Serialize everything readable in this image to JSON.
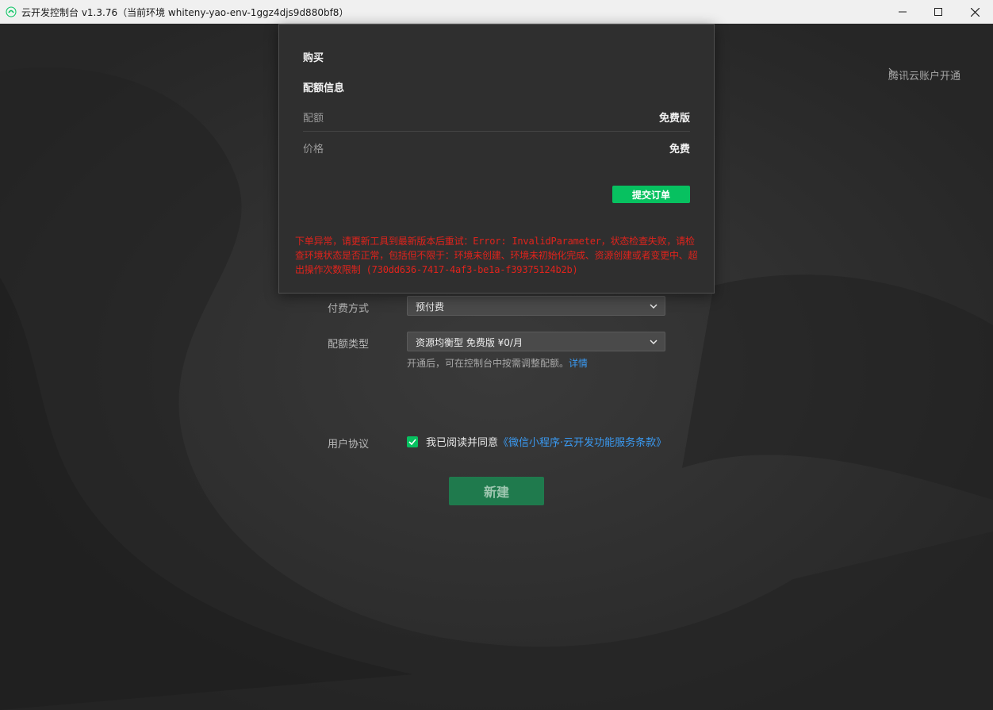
{
  "window": {
    "title": "云开发控制台 v1.3.76（当前环境 whiteny-yao-env-1ggz4djs9d880bf8）",
    "controls": [
      "minimize",
      "maximize",
      "close"
    ]
  },
  "header": {
    "tencent_link": "腾讯云账户开通"
  },
  "popup": {
    "title": "购买",
    "section_title": "配额信息",
    "rows": [
      {
        "label": "配额",
        "value": "免费版"
      },
      {
        "label": "价格",
        "value": "免费"
      }
    ],
    "submit_label": "提交订单",
    "error": "下单异常，请更新工具到最新版本后重试：Error: InvalidParameter，状态检查失败，请检查环境状态是否正常，包括但不限于：环境未创建、环境未初始化完成、资源创建或者变更中、超出操作次数限制 (730dd636-7417-4af3-be1a-f39375124b2b)"
  },
  "form": {
    "payment": {
      "label": "付费方式",
      "value": "预付费"
    },
    "quota": {
      "label": "配额类型",
      "value": "资源均衡型 免费版 ¥0/月"
    },
    "hint": {
      "text": "开通后，可在控制台中按需调整配额。",
      "link": "详情"
    },
    "agreement": {
      "label": "用户协议",
      "text": "我已阅读并同意",
      "link": "《微信小程序·云开发功能服务条款》",
      "checked": true
    },
    "create_label": "新建"
  },
  "colors": {
    "accent": "#07c160",
    "link": "#3a9af2",
    "error": "#e0231c",
    "background": "#2b2b2b"
  }
}
